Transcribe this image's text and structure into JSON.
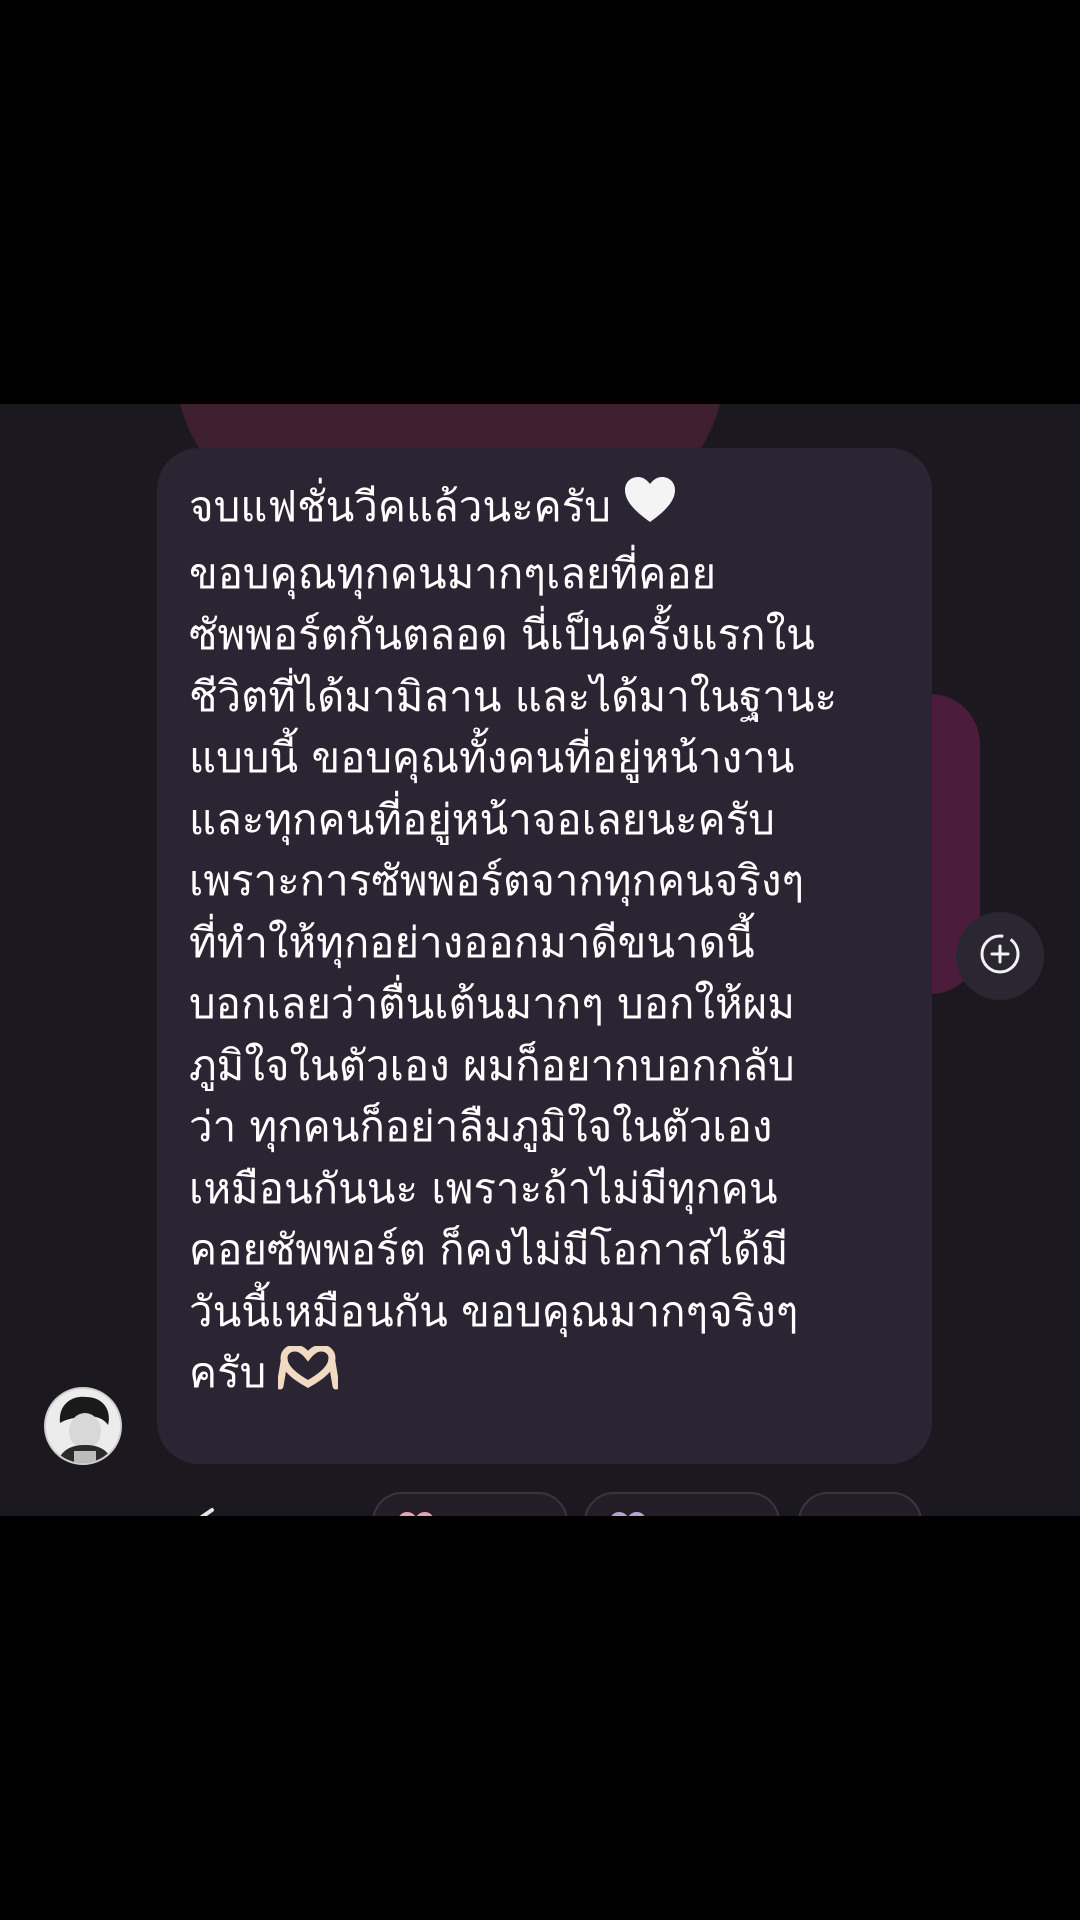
{
  "message": {
    "lines": [
      "จบแฟชั่นวีคแล้วนะครับ",
      "ขอบคุณทุกคนมากๆเลยที่คอย",
      "ซัพพอร์ตกันตลอด นี่เป็นครั้งแรกใน",
      "ชีวิตที่ได้มามิลาน และได้มาในฐานะ",
      "แบบนี้ ขอบคุณทั้งคนที่อยู่หน้างาน",
      "และทุกคนที่อยู่หน้าจอเลยนะครับ",
      "เพราะการซัพพอร์ตจากทุกคนจริงๆ",
      "ที่ทำให้ทุกอย่างออกมาดีขนาดนี้",
      "บอกเลยว่าตื่นเต้นมากๆ บอกให้ผม",
      "ภูมิใจในตัวเอง ผมก็อยากบอกกลับ",
      "ว่า ทุกคนก็อย่าลืมภูมิใจในตัวเอง",
      "เหมือนกันนะ เพราะถ้าไม่มีทุกคน",
      "คอยซัพพอร์ต ก็คงไม่มีโอกาสได้มี",
      "วันนี้เหมือนกัน ขอบคุณมากๆจริงๆ",
      "ครับ"
    ],
    "line1_emoji": "white-heart-icon",
    "last_line_emoji": "heart-hands-icon"
  },
  "icons": {
    "avatar": "avatar",
    "add": "add-reaction-icon",
    "share": "share-icon",
    "reactions": [
      "pink-heart-icon",
      "purple-heart-icon"
    ]
  },
  "colors": {
    "background": "#1c1820",
    "bubble": "#2a2433",
    "text": "#ffffff",
    "accent_blob": "#3d1f30"
  }
}
